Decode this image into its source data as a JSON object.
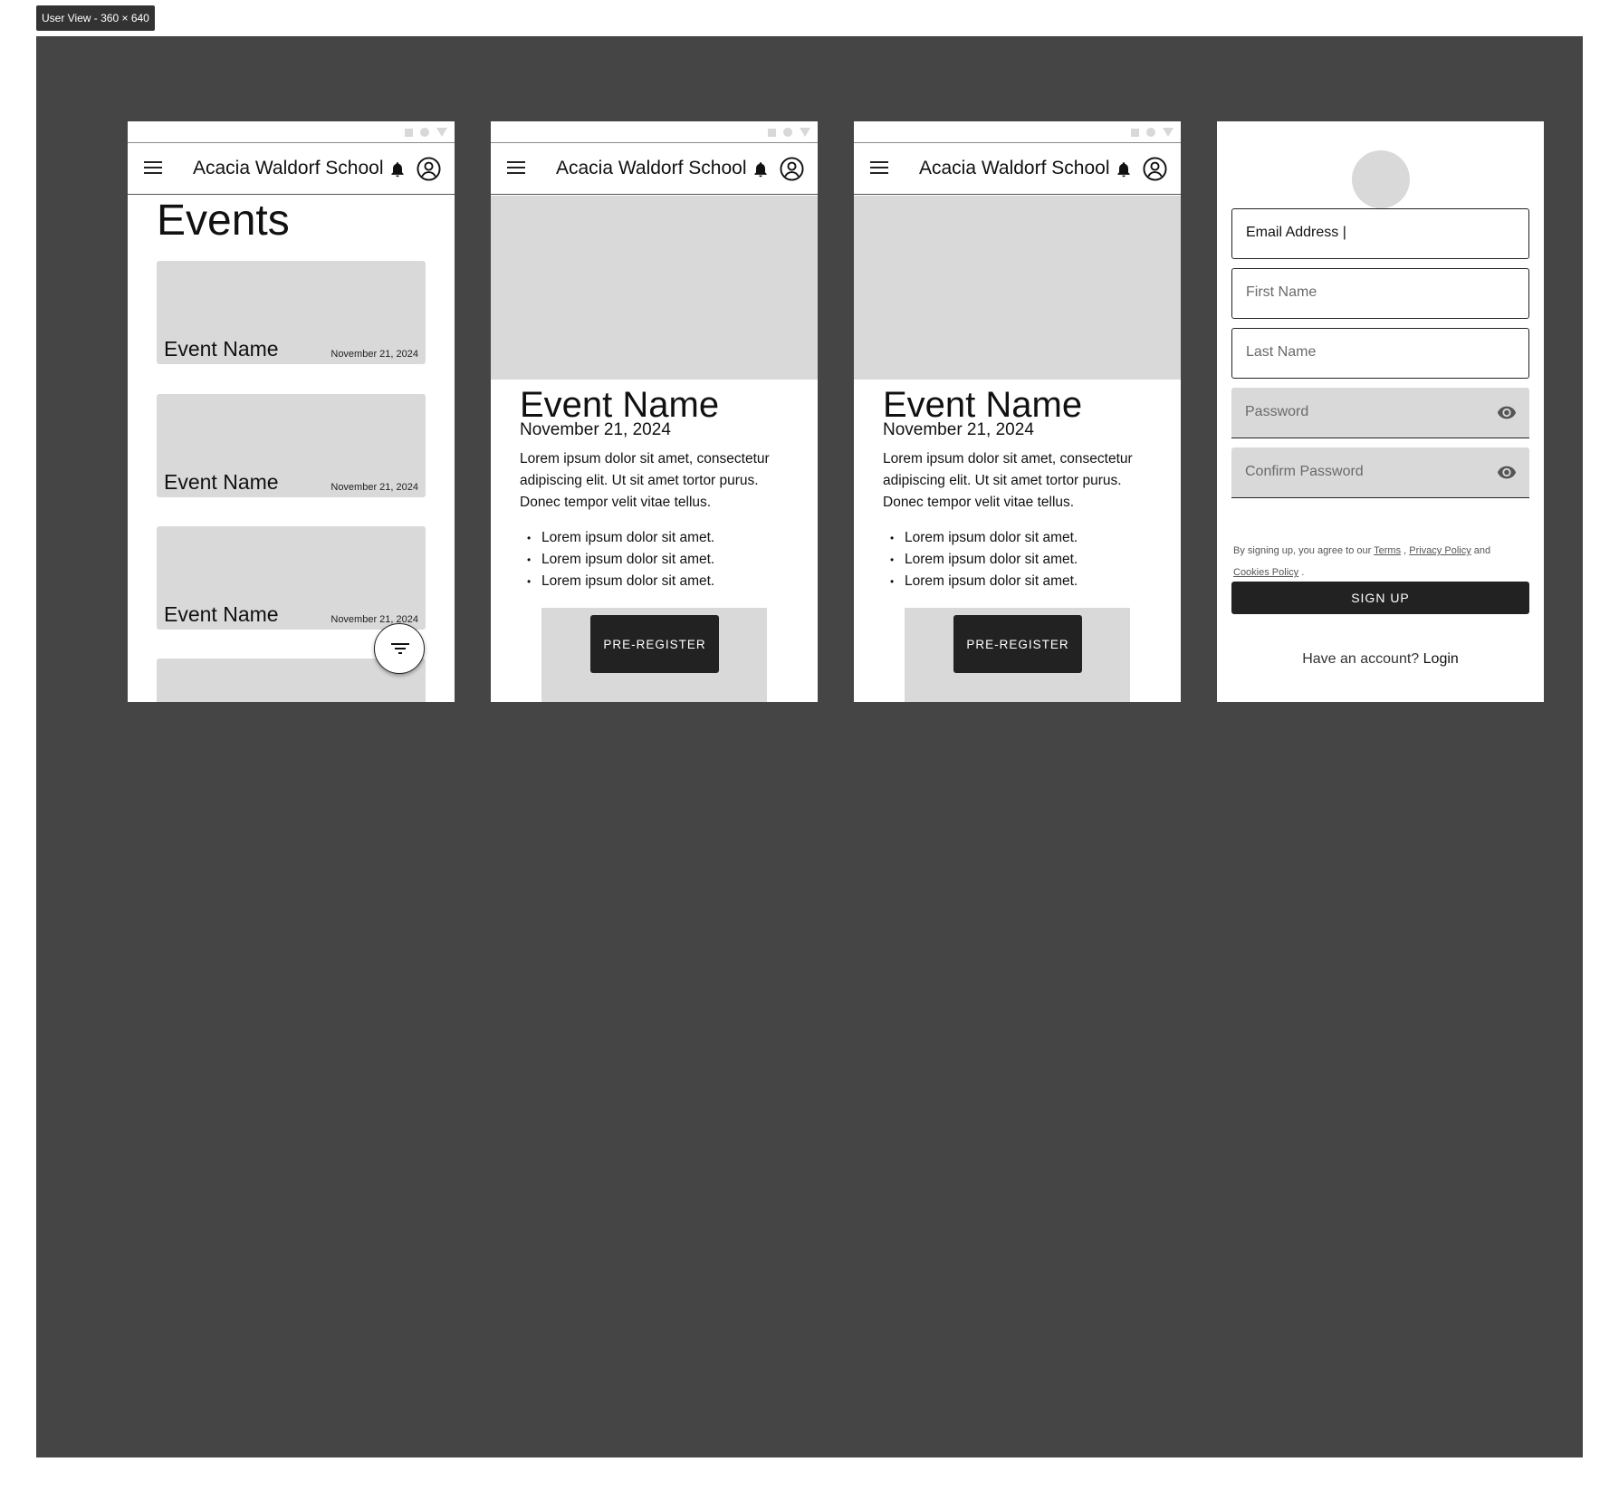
{
  "frame_label": "User View - 360 × 640",
  "app_title": "Acacia Waldorf School",
  "screen1": {
    "heading": "Events",
    "events": [
      {
        "name": "Event Name",
        "date": "November 21, 2024"
      },
      {
        "name": "Event Name",
        "date": "November 21, 2024"
      },
      {
        "name": "Event Name",
        "date": "November 21, 2024"
      }
    ]
  },
  "detail": {
    "title": "Event Name",
    "date": "November 21, 2024",
    "description": "Lorem ipsum dolor sit amet, consectetur adipiscing elit. Ut sit amet tortor purus. Donec tempor velit vitae tellus.",
    "bullets": [
      "Lorem ipsum dolor sit amet.",
      "Lorem ipsum dolor sit amet.",
      "Lorem ipsum dolor sit amet."
    ],
    "button_label": "PRE-REGISTER"
  },
  "signup": {
    "email_value": "Email Address |",
    "first_name_placeholder": "First Name",
    "last_name_placeholder": "Last Name",
    "password_placeholder": "Password",
    "confirm_password_placeholder": "Confirm Password",
    "terms_prefix": "By signing up, you agree to our",
    "terms_link": "Terms",
    "privacy_link": "Privacy Policy",
    "and_text": "and",
    "cookies_link": "Cookies Policy",
    "button_label": "SIGN UP",
    "have_account": "Have an account?",
    "login_link": "Login"
  },
  "colors": {
    "canvas": "#454545",
    "placeholder_gray": "#d9d9d9",
    "button_dark": "#222222"
  }
}
